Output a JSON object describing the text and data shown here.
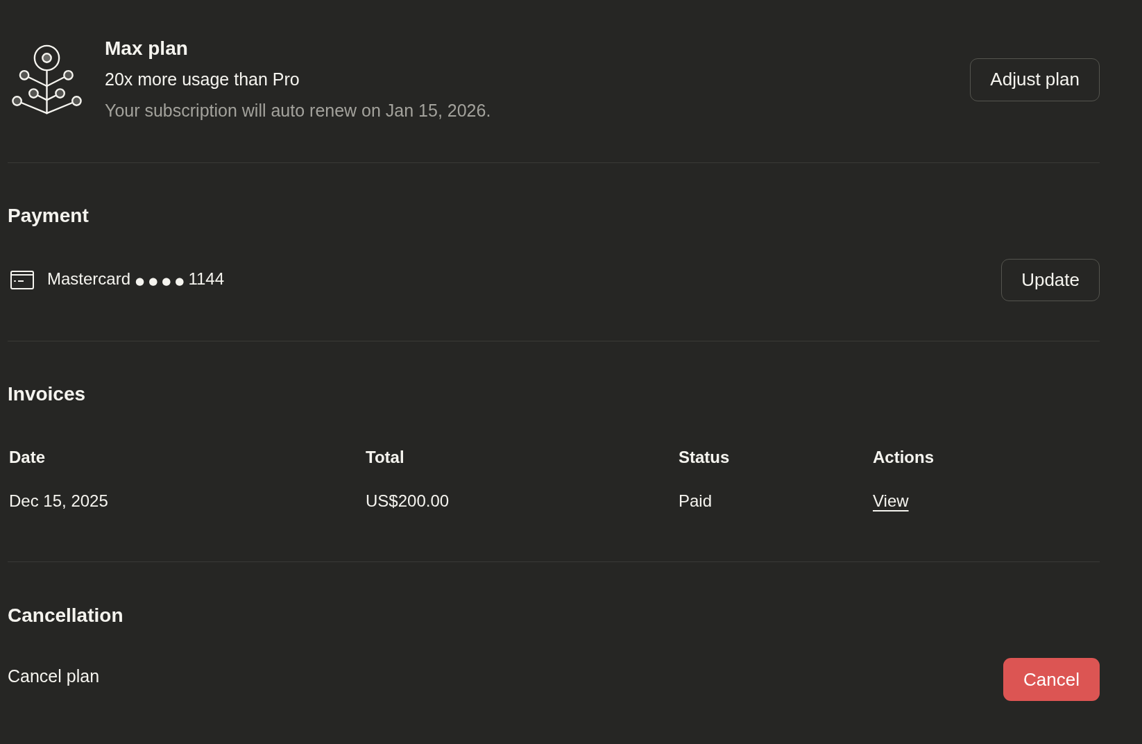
{
  "plan": {
    "name": "Max plan",
    "tagline": "20x more usage than Pro",
    "renewal_note": "Your subscription will auto renew on Jan 15, 2026.",
    "adjust_button": "Adjust plan"
  },
  "payment": {
    "title": "Payment",
    "card_brand": "Mastercard",
    "card_mask": "●●●●",
    "card_last4": "1144",
    "update_button": "Update"
  },
  "invoices": {
    "title": "Invoices",
    "columns": [
      "Date",
      "Total",
      "Status",
      "Actions"
    ],
    "rows": [
      {
        "date": "Dec 15, 2025",
        "total": "US$200.00",
        "status": "Paid",
        "action": "View"
      }
    ]
  },
  "cancellation": {
    "title": "Cancellation",
    "label": "Cancel plan",
    "cancel_button": "Cancel"
  }
}
